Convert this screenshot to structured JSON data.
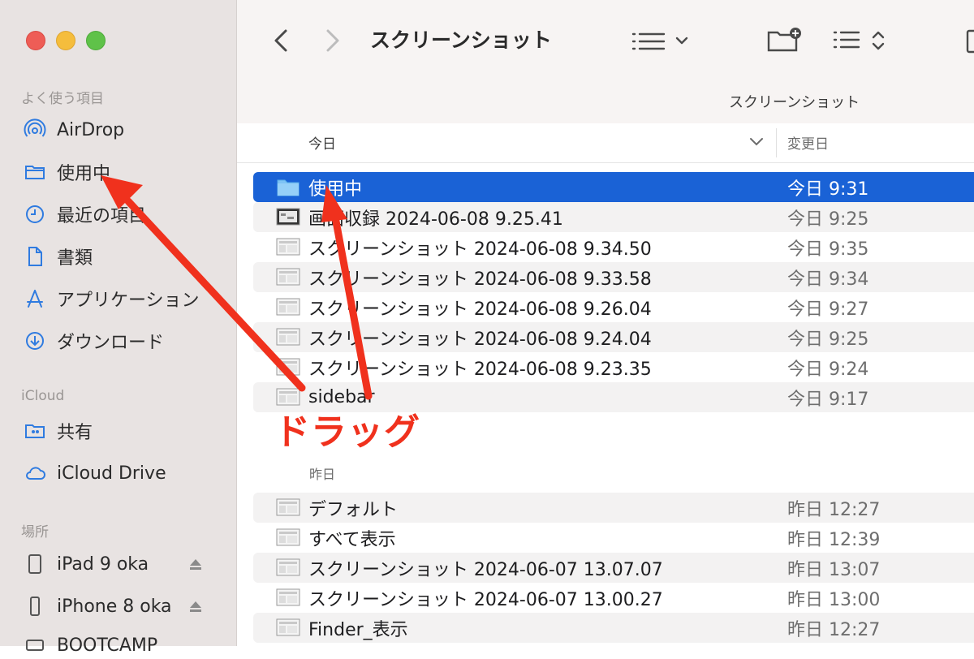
{
  "window": {
    "title": "スクリーンショット",
    "path_label": "スクリーンショット"
  },
  "sidebar": {
    "sections": [
      {
        "heading": "よく使う項目"
      },
      {
        "heading": "iCloud"
      },
      {
        "heading": "場所"
      }
    ],
    "favorites": [
      {
        "label": "AirDrop",
        "icon": "airdrop-icon"
      },
      {
        "label": "使用中",
        "icon": "folder-icon"
      },
      {
        "label": "最近の項目",
        "icon": "clock-icon"
      },
      {
        "label": "書類",
        "icon": "document-icon"
      },
      {
        "label": "アプリケーション",
        "icon": "applications-icon"
      },
      {
        "label": "ダウンロード",
        "icon": "download-icon"
      }
    ],
    "icloud": [
      {
        "label": "共有",
        "icon": "shared-folder-icon"
      },
      {
        "label": "iCloud Drive",
        "icon": "cloud-icon"
      }
    ],
    "locations": [
      {
        "label": "iPad 9 oka",
        "icon": "ipad-icon"
      },
      {
        "label": "iPhone 8 oka",
        "icon": "iphone-icon"
      },
      {
        "label": "BOOTCAMP",
        "icon": "disk-icon"
      }
    ]
  },
  "columns": {
    "name": "今日",
    "date": "変更日"
  },
  "groups": {
    "yesterday_label": "昨日"
  },
  "files_today": [
    {
      "name": "使用中",
      "date": "今日 9:31",
      "kind": "folder",
      "selected": true
    },
    {
      "name": "画面収録 2024-06-08 9.25.41",
      "date": "今日 9:25",
      "kind": "video"
    },
    {
      "name": "スクリーンショット 2024-06-08 9.34.50",
      "date": "今日 9:35",
      "kind": "image"
    },
    {
      "name": "スクリーンショット 2024-06-08 9.33.58",
      "date": "今日 9:34",
      "kind": "image"
    },
    {
      "name": "スクリーンショット 2024-06-08 9.26.04",
      "date": "今日 9:27",
      "kind": "image"
    },
    {
      "name": "スクリーンショット 2024-06-08 9.24.04",
      "date": "今日 9:25",
      "kind": "image"
    },
    {
      "name": "スクリーンショット 2024-06-08 9.23.35",
      "date": "今日 9:24",
      "kind": "image"
    },
    {
      "name": "sidebar",
      "date": "今日 9:17",
      "kind": "image"
    }
  ],
  "files_yesterday": [
    {
      "name": "デフォルト",
      "date": "昨日 12:27",
      "kind": "image"
    },
    {
      "name": "すべて表示",
      "date": "昨日 12:39",
      "kind": "image"
    },
    {
      "name": "スクリーンショット 2024-06-07 13.07.07",
      "date": "昨日 13:07",
      "kind": "image"
    },
    {
      "name": "スクリーンショット 2024-06-07 13.00.27",
      "date": "昨日 13:00",
      "kind": "image"
    },
    {
      "name": "Finder_表示",
      "date": "昨日 12:27",
      "kind": "image"
    }
  ],
  "annotation": {
    "label": "ドラッグ",
    "color": "#f0311d"
  },
  "colors": {
    "selection": "#1a62d6",
    "sidebar_bg": "#e8e3e2",
    "accent_icon": "#2f7be0"
  }
}
